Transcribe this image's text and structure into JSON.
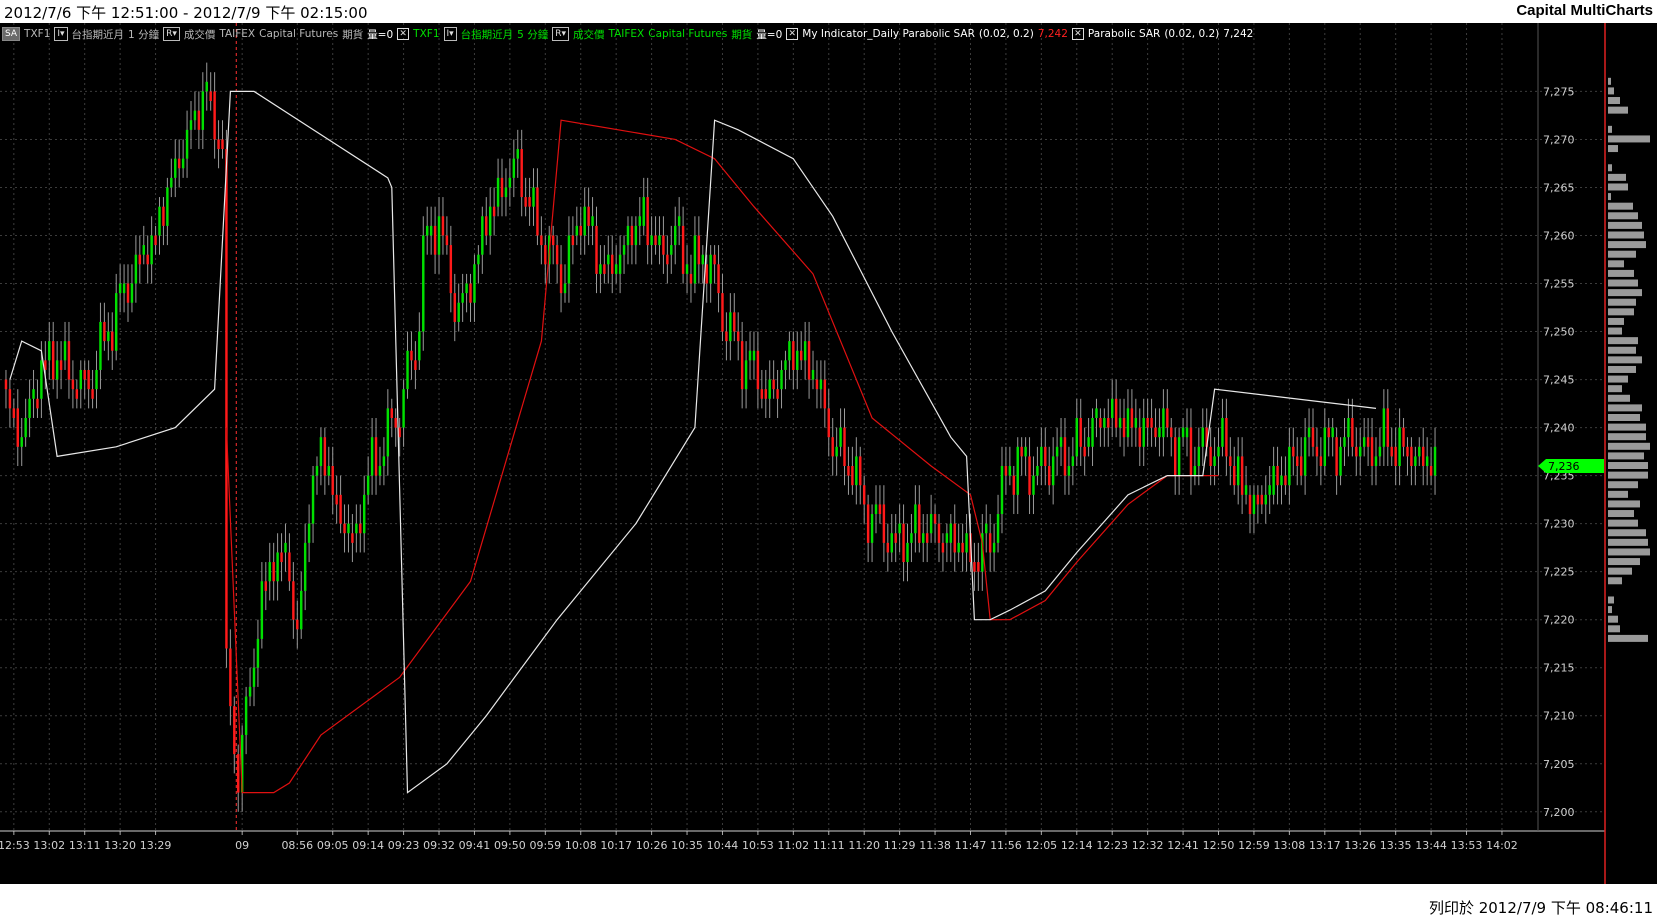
{
  "window": {
    "title_range": "2012/7/6 下午 12:51:00 - 2012/7/9 下午 02:15:00",
    "app_name": "Capital MultiCharts",
    "footer": "列印於 2012/7/9 下午 08:46:11"
  },
  "legend": {
    "sa_button": "SA",
    "s1_symbol": "TXF1",
    "s1_name": "台指期近月",
    "s1_interval": "1 分鐘",
    "s1_field": "成交價",
    "s1_exchange": "TAIFEX",
    "s1_type": "Capital Futures",
    "s1_category": "期貨",
    "s1_volume": "量=0",
    "s2_symbol": "TXF1",
    "s2_name": "台指期近月",
    "s2_interval": "5 分鐘",
    "s2_field": "成交價",
    "s2_exchange": "TAIFEX",
    "s2_type": "Capital Futures",
    "s2_category": "期貨",
    "s2_volume": "量=0",
    "ind1_name": "My Indicator_Daily Parabolic SAR",
    "ind1_params": "(0.02,  0.2)",
    "ind1_value": "7,242",
    "ind2_name": "Parabolic SAR",
    "ind2_params": "(0.02,  0.2)",
    "ind2_value": "7,242"
  },
  "chart_data": {
    "type": "candlestick",
    "colors": {
      "up": "#00e000",
      "down": "#ff1a1a",
      "sar_daily": "#e01010",
      "sar": "#e8e8e8",
      "background": "#000000"
    },
    "ylim": [
      7198,
      7279
    ],
    "y_ticks": [
      7200,
      7205,
      7210,
      7215,
      7220,
      7225,
      7230,
      7235,
      7240,
      7245,
      7250,
      7255,
      7260,
      7265,
      7270,
      7275
    ],
    "y_tick_labels": [
      "7,200",
      "7,205",
      "7,210",
      "7,215",
      "7,220",
      "7,225",
      "7,230",
      "7,235",
      "7,240",
      "7,245",
      "7,250",
      "7,255",
      "7,260",
      "7,265",
      "7,270",
      "7,275"
    ],
    "last_price": 7236,
    "last_price_label": "7,236",
    "x_tick_labels": [
      "12:53",
      "13:02",
      "13:11",
      "13:20",
      "13:29",
      "09",
      "08:56",
      "09:05",
      "09:14",
      "09:23",
      "09:32",
      "09:41",
      "09:50",
      "09:59",
      "10:08",
      "10:17",
      "10:26",
      "10:35",
      "10:44",
      "10:53",
      "11:02",
      "11:11",
      "11:20",
      "11:29",
      "11:38",
      "11:47",
      "11:56",
      "12:05",
      "12:14",
      "12:23",
      "12:32",
      "12:41",
      "12:50",
      "12:59",
      "13:08",
      "13:17",
      "13:26",
      "13:35",
      "13:44",
      "13:53",
      "14:02"
    ],
    "x_tick_bars": [
      2,
      11,
      20,
      29,
      38,
      60,
      74,
      83,
      92,
      101,
      110,
      119,
      128,
      137,
      146,
      155,
      164,
      173,
      182,
      191,
      200,
      209,
      218,
      227,
      236,
      245,
      254,
      263,
      272,
      281,
      290,
      299,
      308,
      317,
      326,
      335,
      344,
      353,
      362,
      371,
      380
    ],
    "session_break_bar": 58.5,
    "bar_count": 364,
    "price_anchors": [
      [
        0,
        7243
      ],
      [
        4,
        7239
      ],
      [
        8,
        7245
      ],
      [
        12,
        7248
      ],
      [
        16,
        7246
      ],
      [
        20,
        7244
      ],
      [
        26,
        7250
      ],
      [
        32,
        7256
      ],
      [
        38,
        7260
      ],
      [
        42,
        7266
      ],
      [
        46,
        7270
      ],
      [
        50,
        7275
      ],
      [
        52,
        7273
      ],
      [
        55,
        7270
      ],
      [
        56,
        7214
      ],
      [
        59,
        7204
      ],
      [
        61,
        7210
      ],
      [
        64,
        7220
      ],
      [
        68,
        7227
      ],
      [
        72,
        7225
      ],
      [
        74,
        7218
      ],
      [
        77,
        7232
      ],
      [
        80,
        7238
      ],
      [
        84,
        7232
      ],
      [
        88,
        7228
      ],
      [
        92,
        7235
      ],
      [
        96,
        7238
      ],
      [
        100,
        7242
      ],
      [
        104,
        7248
      ],
      [
        106,
        7258
      ],
      [
        110,
        7262
      ],
      [
        114,
        7252
      ],
      [
        118,
        7255
      ],
      [
        122,
        7262
      ],
      [
        126,
        7265
      ],
      [
        130,
        7268
      ],
      [
        134,
        7262
      ],
      [
        138,
        7258
      ],
      [
        142,
        7256
      ],
      [
        146,
        7263
      ],
      [
        150,
        7258
      ],
      [
        154,
        7256
      ],
      [
        158,
        7260
      ],
      [
        162,
        7262
      ],
      [
        166,
        7258
      ],
      [
        170,
        7260
      ],
      [
        174,
        7256
      ],
      [
        178,
        7258
      ],
      [
        182,
        7252
      ],
      [
        186,
        7248
      ],
      [
        190,
        7246
      ],
      [
        194,
        7243
      ],
      [
        198,
        7247
      ],
      [
        202,
        7248
      ],
      [
        206,
        7245
      ],
      [
        210,
        7238
      ],
      [
        214,
        7237
      ],
      [
        218,
        7232
      ],
      [
        222,
        7230
      ],
      [
        226,
        7228
      ],
      [
        230,
        7229
      ],
      [
        234,
        7230
      ],
      [
        238,
        7228
      ],
      [
        242,
        7228
      ],
      [
        246,
        7226
      ],
      [
        250,
        7228
      ],
      [
        254,
        7235
      ],
      [
        258,
        7236
      ],
      [
        262,
        7235
      ],
      [
        266,
        7237
      ],
      [
        270,
        7237
      ],
      [
        274,
        7239
      ],
      [
        278,
        7241
      ],
      [
        282,
        7241
      ],
      [
        286,
        7240
      ],
      [
        290,
        7240
      ],
      [
        294,
        7240
      ],
      [
        298,
        7238
      ],
      [
        302,
        7237
      ],
      [
        306,
        7238
      ],
      [
        310,
        7238
      ],
      [
        314,
        7233
      ],
      [
        318,
        7232
      ],
      [
        322,
        7234
      ],
      [
        326,
        7236
      ],
      [
        330,
        7238
      ],
      [
        334,
        7238
      ],
      [
        338,
        7238
      ],
      [
        342,
        7239
      ],
      [
        346,
        7237
      ],
      [
        350,
        7239
      ],
      [
        354,
        7238
      ],
      [
        358,
        7237
      ],
      [
        363,
        7236
      ]
    ],
    "series": [
      {
        "name": "My Indicator_Daily Parabolic SAR",
        "color": "#e01010",
        "points": [
          [
            56,
            7240
          ],
          [
            60,
            7202
          ],
          [
            68,
            7202
          ],
          [
            72,
            7203
          ],
          [
            80,
            7208
          ],
          [
            100,
            7214
          ],
          [
            118,
            7224
          ],
          [
            136,
            7249
          ],
          [
            141,
            7272
          ],
          [
            170,
            7270
          ],
          [
            180,
            7268
          ],
          [
            190,
            7263
          ],
          [
            205,
            7256
          ],
          [
            220,
            7241
          ],
          [
            235,
            7236
          ],
          [
            245,
            7233
          ],
          [
            248,
            7228
          ],
          [
            250,
            7220
          ],
          [
            255,
            7220
          ],
          [
            264,
            7222
          ],
          [
            272,
            7226
          ],
          [
            285,
            7232
          ],
          [
            295,
            7235
          ],
          [
            308,
            7235
          ]
        ]
      },
      {
        "name": "Parabolic SAR",
        "color": "#e8e8e8",
        "points": [
          [
            1,
            7245
          ],
          [
            4,
            7249
          ],
          [
            9,
            7248
          ],
          [
            13,
            7237
          ],
          [
            28,
            7238
          ],
          [
            43,
            7240
          ],
          [
            53,
            7244
          ],
          [
            57,
            7275
          ],
          [
            63,
            7275
          ],
          [
            97,
            7266
          ],
          [
            98,
            7265
          ],
          [
            102,
            7202
          ],
          [
            112,
            7205
          ],
          [
            122,
            7210
          ],
          [
            140,
            7220
          ],
          [
            160,
            7230
          ],
          [
            175,
            7240
          ],
          [
            180,
            7272
          ],
          [
            186,
            7271
          ],
          [
            200,
            7268
          ],
          [
            210,
            7262
          ],
          [
            225,
            7250
          ],
          [
            240,
            7239
          ],
          [
            244,
            7237
          ],
          [
            246,
            7220
          ],
          [
            250,
            7220
          ],
          [
            255,
            7221
          ],
          [
            264,
            7223
          ],
          [
            272,
            7227
          ],
          [
            285,
            7233
          ],
          [
            295,
            7235
          ],
          [
            304,
            7235
          ],
          [
            307,
            7244
          ],
          [
            348,
            7242
          ]
        ]
      }
    ],
    "volume_profile": {
      "prices": [
        7276,
        7275,
        7274,
        7273,
        7271,
        7270,
        7269,
        7267,
        7266,
        7265,
        7264,
        7263,
        7262,
        7261,
        7260,
        7259,
        7258,
        7257,
        7256,
        7255,
        7254,
        7253,
        7252,
        7251,
        7250,
        7249,
        7248,
        7247,
        7246,
        7245,
        7244,
        7243,
        7242,
        7241,
        7240,
        7239,
        7238,
        7237,
        7236,
        7235,
        7234,
        7233,
        7232,
        7231,
        7230,
        7229,
        7228,
        7227,
        7226,
        7225,
        7224,
        7222,
        7221,
        7220,
        7219,
        7218
      ],
      "widths": [
        3,
        6,
        12,
        20,
        4,
        42,
        10,
        4,
        18,
        20,
        3,
        25,
        30,
        34,
        36,
        38,
        28,
        16,
        26,
        30,
        34,
        28,
        26,
        16,
        14,
        30,
        28,
        34,
        28,
        20,
        14,
        22,
        34,
        32,
        38,
        38,
        42,
        36,
        40,
        40,
        30,
        20,
        32,
        26,
        30,
        38,
        40,
        42,
        32,
        24,
        14,
        6,
        4,
        10,
        12,
        40
      ]
    }
  }
}
